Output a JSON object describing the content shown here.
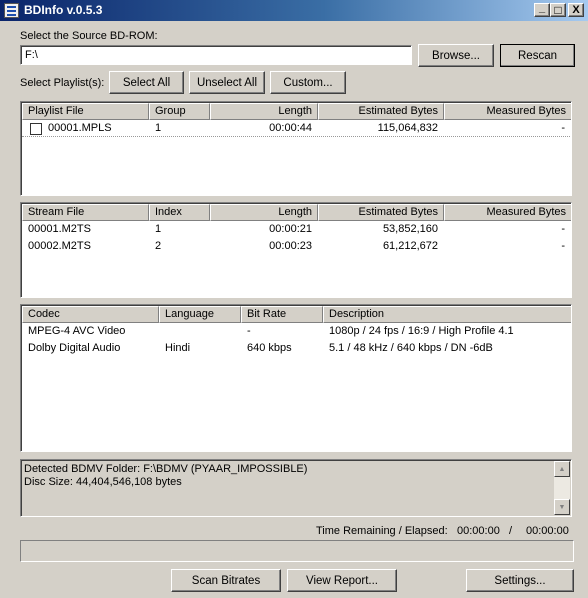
{
  "window": {
    "title": "BDInfo v.0.5.3",
    "controls": {
      "minimize": "_",
      "maximize": "□",
      "close": "X"
    }
  },
  "source": {
    "label": "Select the Source BD-ROM:",
    "path_value": "F:\\",
    "browse_label": "Browse...",
    "rescan_label": "Rescan"
  },
  "playlist_select": {
    "label": "Select Playlist(s):",
    "select_all_label": "Select All",
    "unselect_all_label": "Unselect All",
    "custom_label": "Custom..."
  },
  "playlists": {
    "columns": [
      "Playlist File",
      "Group",
      "Length",
      "Estimated Bytes",
      "Measured Bytes"
    ],
    "rows": [
      {
        "checked": false,
        "file": "00001.MPLS",
        "group": "1",
        "length": "00:00:44",
        "estimated": "115,064,832",
        "measured": "-"
      }
    ]
  },
  "streams": {
    "columns": [
      "Stream File",
      "Index",
      "Length",
      "Estimated Bytes",
      "Measured Bytes"
    ],
    "rows": [
      {
        "file": "00001.M2TS",
        "index": "1",
        "length": "00:00:21",
        "estimated": "53,852,160",
        "measured": "-"
      },
      {
        "file": "00002.M2TS",
        "index": "2",
        "length": "00:00:23",
        "estimated": "61,212,672",
        "measured": "-"
      }
    ]
  },
  "codecs": {
    "columns": [
      "Codec",
      "Language",
      "Bit Rate",
      "Description"
    ],
    "rows": [
      {
        "codec": "MPEG-4 AVC Video",
        "language": "",
        "bitrate": "-",
        "description": "1080p / 24 fps / 16:9 / High Profile 4.1"
      },
      {
        "codec": "Dolby Digital Audio",
        "language": "Hindi",
        "bitrate": "640 kbps",
        "description": "5.1 / 48 kHz / 640 kbps / DN -6dB"
      }
    ]
  },
  "log": {
    "lines": [
      "Detected BDMV Folder: F:\\BDMV (PYAAR_IMPOSSIBLE)",
      "Disc Size: 44,404,546,108 bytes"
    ]
  },
  "time": {
    "label": "Time Remaining / Elapsed:",
    "remaining": "00:00:00",
    "separator": "/",
    "elapsed": "00:00:00"
  },
  "progress": {
    "fraction": 0
  },
  "bottom": {
    "scan_label": "Scan Bitrates",
    "report_label": "View Report...",
    "settings_label": "Settings..."
  }
}
